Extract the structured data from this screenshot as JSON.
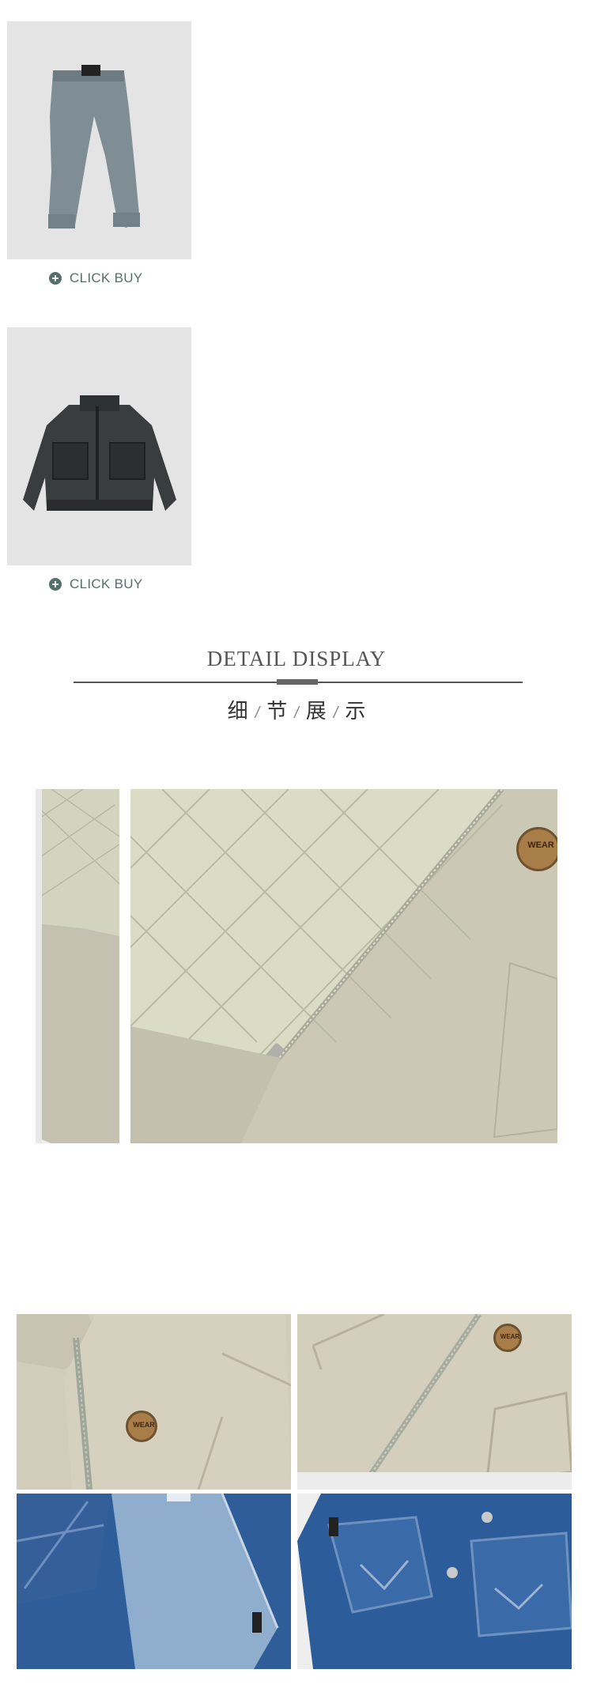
{
  "products": [
    {
      "name": "pants",
      "cta": "CLICK BUY"
    },
    {
      "name": "jacket",
      "cta": "CLICK BUY"
    }
  ],
  "detail": {
    "title_en": "DETAIL DISPLAY",
    "title_cn": [
      "细",
      "节",
      "展",
      "示"
    ],
    "separator": "/"
  },
  "badge": {
    "text": "WEAR"
  },
  "colors": {
    "accent": "#55706b",
    "product_bg": "#e3e4e3",
    "beige": "#c9c5b3",
    "lining": "#d8dbc4",
    "denim": "#2f5d9a"
  }
}
